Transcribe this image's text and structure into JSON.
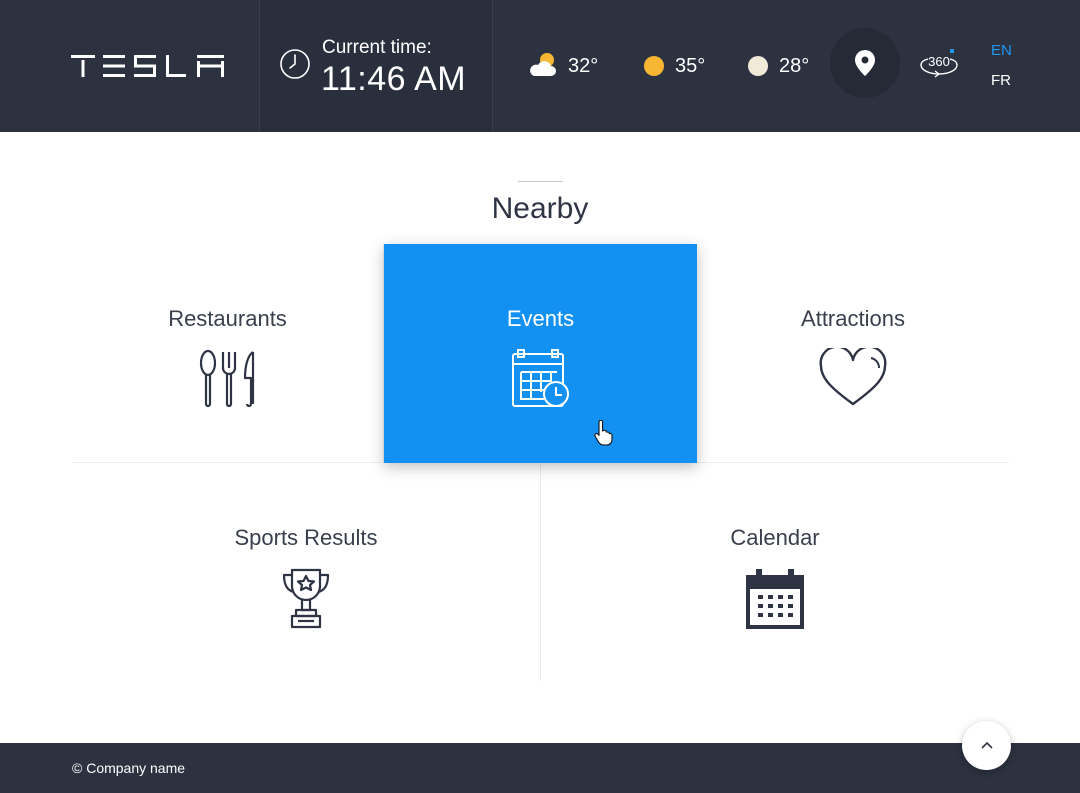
{
  "header": {
    "brand": "TESLA",
    "time_label": "Current time:",
    "time_value": "11:46 AM",
    "weather": [
      {
        "icon": "cloud-sun-icon",
        "temp": "32°"
      },
      {
        "icon": "sun-icon",
        "temp": "35°"
      },
      {
        "icon": "moon-icon",
        "temp": "28°"
      }
    ],
    "location_icon": "location-pin-icon",
    "view360_icon": "view-360-icon",
    "languages": [
      "EN",
      "FR"
    ],
    "active_language": "EN"
  },
  "section": {
    "title": "Nearby",
    "tiles": [
      {
        "label": "Restaurants",
        "icon": "cutlery-icon"
      },
      {
        "label": "Events",
        "icon": "event-calendar-icon"
      },
      {
        "label": "Attractions",
        "icon": "heart-icon"
      },
      {
        "label": "Sports Results",
        "icon": "trophy-icon"
      },
      {
        "label": "Calendar",
        "icon": "calendar-icon"
      }
    ]
  },
  "footer": {
    "copyright": "© Company name"
  },
  "colors": {
    "header_bg": "#2d3241",
    "accent": "#1291f3",
    "active_lang": "#2196f3",
    "sun": "#f7b733"
  }
}
